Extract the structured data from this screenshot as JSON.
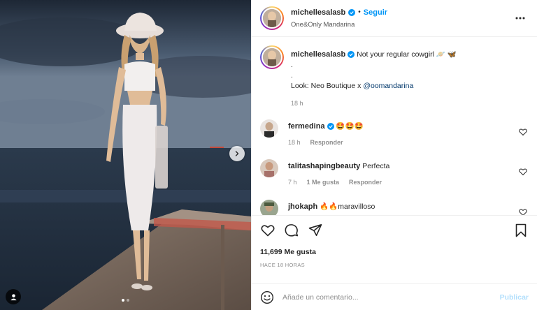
{
  "header": {
    "username": "michellesalasb",
    "separator": "•",
    "follow_label": "Seguir",
    "location": "One&Only Mandarina"
  },
  "caption": {
    "username": "michellesalasb",
    "text": "Not your regular cowgirl 🪐 🦋",
    "line2": ".",
    "line3": ".",
    "look_prefix": "Look: Neo Boutique x ",
    "look_mention": "@oomandarina",
    "time": "18 h"
  },
  "comments": [
    {
      "username": "fermedina",
      "verified": true,
      "text": "🤩🤩🤩",
      "time": "18 h",
      "likes": "",
      "reply": "Responder"
    },
    {
      "username": "talitashapingbeauty",
      "verified": false,
      "text": "Perfecta",
      "time": "7 h",
      "likes": "1 Me gusta",
      "reply": "Responder"
    },
    {
      "username": "jhokaph",
      "verified": false,
      "text": "🔥🔥maravilloso",
      "time": "",
      "likes": "",
      "reply": ""
    }
  ],
  "actions": {
    "likes": "11,699 Me gusta",
    "time_ago": "HACE 18 HORAS"
  },
  "add_comment": {
    "placeholder": "Añade un comentario...",
    "publish_label": "Publicar"
  },
  "carousel": {
    "dots": 2,
    "active": 0
  },
  "icons": {
    "verified": "verified-badge-icon",
    "more": "more-horizontal-icon",
    "like": "heart-icon",
    "comment": "comment-bubble-icon",
    "share": "paper-plane-icon",
    "save": "bookmark-icon",
    "emoji": "emoji-smiley-icon",
    "next": "chevron-right-icon",
    "user_tag": "user-tag-icon"
  },
  "colors": {
    "accent": "#0095f6",
    "publish_disabled": "#b2dffc",
    "mention": "#00376b",
    "muted": "#8e8e8e"
  }
}
